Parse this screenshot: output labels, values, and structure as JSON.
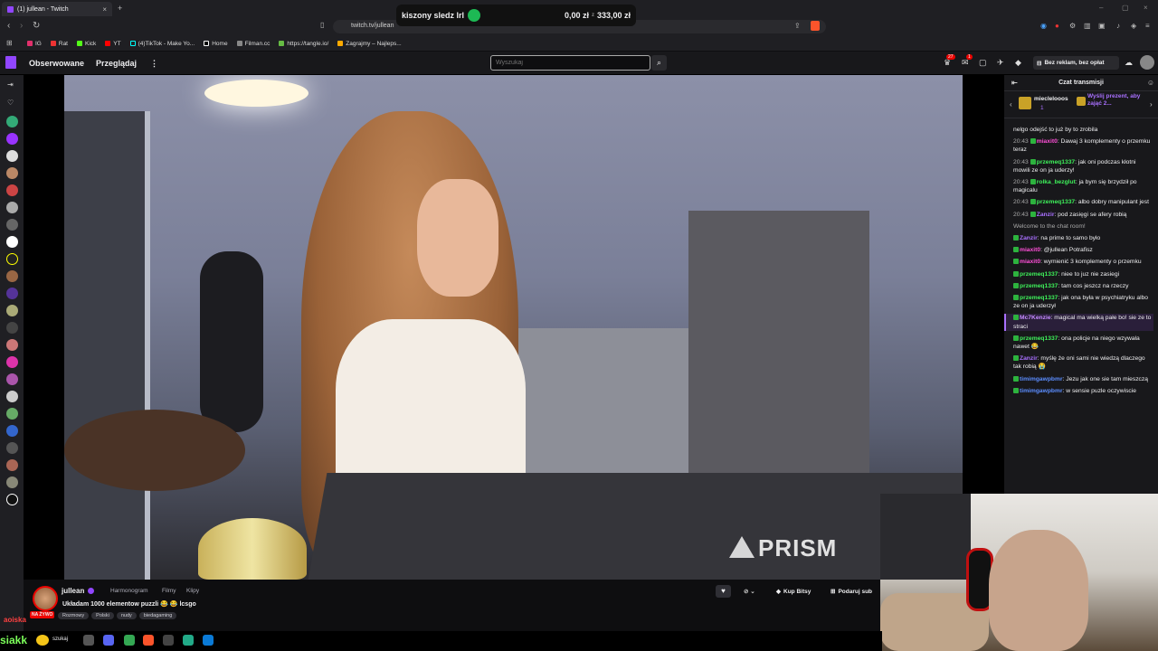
{
  "browser": {
    "tab_title": "(1) jullean - Twitch",
    "url": "twitch.tv/jullean",
    "bookmarks": [
      "IG",
      "Rat",
      "Kick",
      "YT",
      "(4)TikTok - Make Yo...",
      "Home",
      "Filman.cc",
      "https://tangle.io/",
      "Zagrajmy – Najleps..."
    ]
  },
  "overlay": {
    "label": "kiszony sledz lrl",
    "amount_left": "0,00 zł",
    "sep": "z",
    "amount_right": "333,00 zł"
  },
  "twitch_header": {
    "following": "Obserwowane",
    "browse": "Przeglądaj",
    "more": "⋮",
    "search_placeholder": "Wyszukaj",
    "notif_badge_1": "27",
    "notif_badge_2": "1",
    "ad_free": "Bez reklam, bez opłat"
  },
  "stream": {
    "watermark": "PRISM",
    "channel": "jullean",
    "links": [
      "Harmonogram",
      "Filmy",
      "Klipy"
    ],
    "title": "Układam 1000 elementow puzzli 😂 😂 lcsgo",
    "live": "NA ŻYWO",
    "tags": [
      "Rozmowy",
      "Polski",
      "nudy",
      "biedagaming"
    ],
    "buy_bits": "Kup Bitsy",
    "gift_sub": "Podaruj sub"
  },
  "chat": {
    "title": "Czat transmisji",
    "gift_user": "mieclelooos",
    "gift_count": "1",
    "gift_text": "Wyślij prezent, aby zająć 2...",
    "messages": [
      {
        "time": "",
        "user": "",
        "text": "nelgo odejść to już by to zrobila",
        "color": "#efeff1"
      },
      {
        "time": "20:43",
        "user": "miaxit0",
        "text": ": Dawaj 3 komplementy o przemku teraz",
        "color": "#ff4fd8"
      },
      {
        "time": "20:43",
        "user": "przemeq1337",
        "text": ": jak oni podczas kłotni mowili ze on ja uderzy!",
        "color": "#3ef05a"
      },
      {
        "time": "20:43",
        "user": "rolka_bezglut",
        "text": ": ja bym się brzydził po magicalu",
        "color": "#3ef05a"
      },
      {
        "time": "20:43",
        "user": "przemeq1337",
        "text": ": albo dobry manipulant jest",
        "color": "#3ef05a"
      },
      {
        "time": "20:43",
        "user": "Zanzir",
        "text": ": pod zasięgi se afery robią",
        "color": "#a970ff"
      }
    ],
    "system": "Welcome to the chat room!",
    "messages2": [
      {
        "user": "Zanzir",
        "text": ": na prime to samo było",
        "color": "#a970ff"
      },
      {
        "user": "miaxit0",
        "text": ": @jullean Potrafisz",
        "color": "#ff4fd8"
      },
      {
        "user": "miaxit0",
        "text": ": wymienić 3 komplementy o przemku",
        "color": "#ff4fd8"
      },
      {
        "user": "przemeq1337",
        "text": ": niee to juz nie zasiegi",
        "color": "#3ef05a"
      },
      {
        "user": "przemeq1337",
        "text": ": tam cos jeszcz na rzeczy",
        "color": "#3ef05a"
      },
      {
        "user": "przemeq1337",
        "text": ": jak ona była w psychiatryku albo ze on ja uderzył",
        "color": "#3ef05a"
      },
      {
        "user": "Mc7Kenzie",
        "text": ": magical ma wielką pałe bo! sie ze to straci",
        "color": "#c58bff",
        "hl": true
      },
      {
        "user": "przemeq1337",
        "text": ": ona policje na niego wzywała nawet 😂",
        "color": "#3ef05a"
      },
      {
        "user": "Zanzir",
        "text": ": myślę że oni sami nie wiedzą dlaczego tak robią 😭",
        "color": "#a970ff"
      },
      {
        "user": "timimgawpbmr",
        "text": ": Jezu jak one sie tam mieszczą",
        "color": "#5b8dff"
      },
      {
        "user": "timimgawpbmr",
        "text": ": w sensie puzle oczywiscie",
        "color": "#5b8dff"
      }
    ]
  },
  "taskbar": {
    "left_text": "siakk",
    "search": "szukaj",
    "red_text": "aoiska"
  },
  "colors": {
    "twitch_purple": "#9146ff",
    "live_red": "#eb0400"
  }
}
